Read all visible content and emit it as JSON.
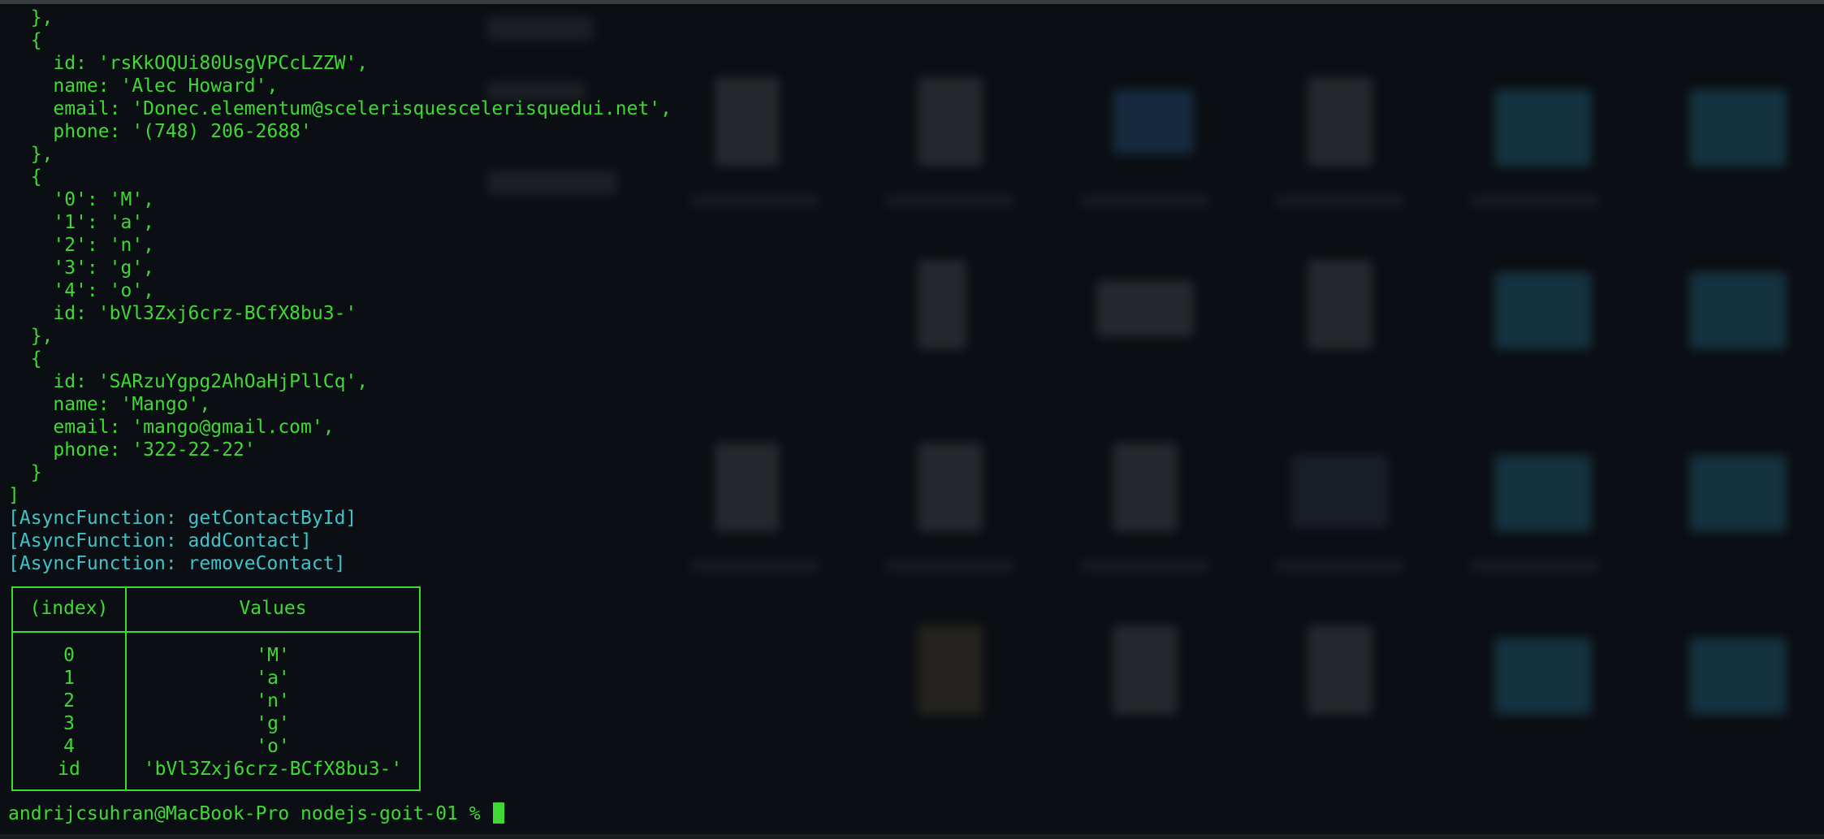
{
  "terminal": {
    "lines": [
      "  },",
      "  {",
      "    id: 'rsKkOQUi80UsgVPCcLZZW',",
      "    name: 'Alec Howard',",
      "    email: 'Donec.elementum@scelerisquescelerisquedui.net',",
      "    phone: '(748) 206-2688'",
      "  },",
      "  {",
      "    '0': 'M',",
      "    '1': 'a',",
      "    '2': 'n',",
      "    '3': 'g',",
      "    '4': 'o',",
      "    id: 'bVl3Zxj6crz-BCfX8bu3-'",
      "  },",
      "  {",
      "    id: 'SARzuYgpg2AhOaHjPllCq',",
      "    name: 'Mango',",
      "    email: 'mango@gmail.com',",
      "    phone: '322-22-22'",
      "  }",
      "]"
    ],
    "function_lines": [
      "[AsyncFunction: getContactById]",
      "[AsyncFunction: addContact]",
      "[AsyncFunction: removeContact]"
    ]
  },
  "table": {
    "headers": [
      "(index)",
      "Values"
    ],
    "rows": [
      {
        "index": "0",
        "value": "'M'"
      },
      {
        "index": "1",
        "value": "'a'"
      },
      {
        "index": "2",
        "value": "'n'"
      },
      {
        "index": "3",
        "value": "'g'"
      },
      {
        "index": "4",
        "value": "'o'"
      },
      {
        "index": "id",
        "value": "'bVl3Zxj6crz-BCfX8bu3-'"
      }
    ]
  },
  "prompt": {
    "text": "andrijcsuhran@MacBook-Pro nodejs-goit-01 % "
  },
  "colors": {
    "text": "#3fd934",
    "function": "#3fc3c8",
    "background": "#0b0f13"
  }
}
